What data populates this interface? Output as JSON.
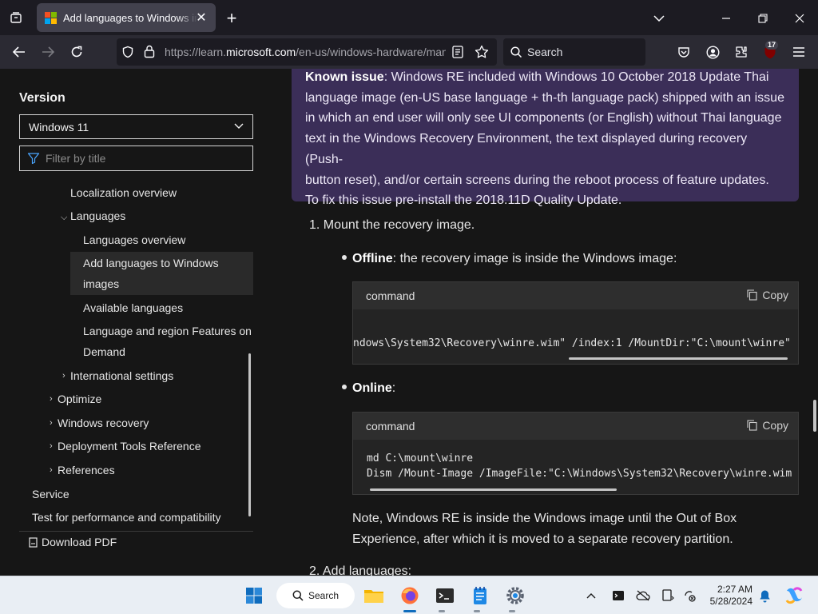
{
  "browser": {
    "tab_title": "Add languages to Windows images",
    "url_host_prefix": "https://learn.",
    "url_host": "microsoft.com",
    "url_path": "/en-us/windows-hardware/manufacture/desktop/add-language-packs-to-windows",
    "search_placeholder": "Search",
    "extensions_badge": "17"
  },
  "sidebar": {
    "heading": "Version",
    "version_selected": "Windows 11",
    "filter_placeholder": "Filter by title",
    "toc": [
      {
        "label": "Localization overview"
      },
      {
        "label": "Languages"
      },
      {
        "label": "Languages overview"
      },
      {
        "label": "Add languages to Windows"
      },
      {
        "label": "images"
      },
      {
        "label": "Available languages"
      },
      {
        "label": "Language and region Features on"
      },
      {
        "label": "Demand"
      },
      {
        "label": "International settings"
      },
      {
        "label": "Optimize"
      },
      {
        "label": "Windows recovery"
      },
      {
        "label": "Deployment Tools Reference"
      },
      {
        "label": "References"
      },
      {
        "label": "Service"
      },
      {
        "label": "Test for performance and compatibility"
      }
    ],
    "download_pdf": "Download PDF"
  },
  "main": {
    "alert": {
      "bold": "Known issue",
      "line1": ": Windows RE included with Windows 10 October 2018 Update Thai",
      "line2": "language image (en-US base language + th-th language pack) shipped with an issue",
      "line3": "in which an end user will only see UI components (or English) without Thai language",
      "line4": "text in the Windows Recovery Environment, the text displayed during recovery (Push-",
      "line5": "button reset), and/or certain screens during the reboot process of feature updates.",
      "line6": "To fix this issue pre-install the 2018.11D Quality Update."
    },
    "step1": "1. Mount the recovery image.",
    "offline_bold": "Offline",
    "offline_text": ": the recovery image is inside the Windows image:",
    "code1": {
      "label": "command",
      "copy": "Copy",
      "line1": "ndows\\System32\\Recovery\\winre.wim\" /index:1 /MountDir:\"C:\\mount\\winre\""
    },
    "online_bold": "Online",
    "online_text": ":",
    "code2": {
      "label": "command",
      "copy": "Copy",
      "line1": "md C:\\mount\\winre",
      "line2": "Dism /Mount-Image /ImageFile:\"C:\\Windows\\System32\\Recovery\\winre.wim"
    },
    "note_line1": "Note, Windows RE is inside the Windows image until the Out of Box",
    "note_line2": "Experience, after which it is moved to a separate recovery partition.",
    "step2": "2. Add languages:"
  },
  "taskbar": {
    "search_label": "Search",
    "time": "2:27 AM",
    "date": "5/28/2024"
  }
}
